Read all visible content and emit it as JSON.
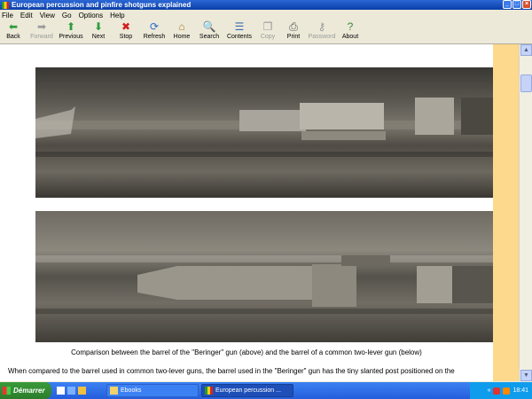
{
  "window": {
    "title": "European percussion and pinfire shotguns explained"
  },
  "menu": [
    "File",
    "Edit",
    "View",
    "Go",
    "Options",
    "Help"
  ],
  "toolbar": [
    {
      "name": "back-button",
      "label": "Back",
      "icon": "arrow-left-icon",
      "glyph": "⬅",
      "color": "#2e9c3c",
      "enabled": true
    },
    {
      "name": "forward-button",
      "label": "Forward",
      "icon": "arrow-right-icon",
      "glyph": "➡",
      "color": "#9a9a9a",
      "enabled": false
    },
    {
      "name": "previous-button",
      "label": "Previous",
      "icon": "arrow-up-icon",
      "glyph": "⬆",
      "color": "#2e9c3c",
      "enabled": true
    },
    {
      "name": "next-button",
      "label": "Next",
      "icon": "arrow-down-icon",
      "glyph": "⬇",
      "color": "#2e9c3c",
      "enabled": true
    },
    {
      "name": "stop-button",
      "label": "Stop",
      "icon": "stop-icon",
      "glyph": "✖",
      "color": "#d02020",
      "enabled": true
    },
    {
      "name": "refresh-button",
      "label": "Refresh",
      "icon": "refresh-icon",
      "glyph": "⟳",
      "color": "#2a6dc9",
      "enabled": true
    },
    {
      "name": "home-button",
      "label": "Home",
      "icon": "home-icon",
      "glyph": "⌂",
      "color": "#b07a2a",
      "enabled": true
    },
    {
      "name": "search-button",
      "label": "Search",
      "icon": "search-icon",
      "glyph": "🔍",
      "color": "#4a6a9a",
      "enabled": true
    },
    {
      "name": "contents-button",
      "label": "Contents",
      "icon": "contents-icon",
      "glyph": "☰",
      "color": "#3a6ab0",
      "enabled": true
    },
    {
      "name": "copy-button",
      "label": "Copy",
      "icon": "copy-icon",
      "glyph": "❐",
      "color": "#9a9a9a",
      "enabled": false
    },
    {
      "name": "print-button",
      "label": "Print",
      "icon": "printer-icon",
      "glyph": "⎙",
      "color": "#555555",
      "enabled": true
    },
    {
      "name": "password-button",
      "label": "Password",
      "icon": "key-icon",
      "glyph": "⚷",
      "color": "#9a9a9a",
      "enabled": false
    },
    {
      "name": "about-button",
      "label": "About",
      "icon": "about-icon",
      "glyph": "?",
      "color": "#3a8a3a",
      "enabled": true
    }
  ],
  "content": {
    "caption": "Comparison between the barrel of the \"Beringer\" gun (above) and the barrel of a common two-lever gun (below)",
    "body_text": "When compared to the barrel used in common two-lever guns, the barrel used in the \"Beringer\" gun has the tiny slanted post positioned on the"
  },
  "taskbar": {
    "start_label": "Démarrer",
    "items": [
      {
        "name": "taskbar-ebooks",
        "label": "Ebooks",
        "active": false
      },
      {
        "name": "taskbar-browser",
        "label": "European percussion ...",
        "active": true
      }
    ],
    "clock": "18:41"
  }
}
